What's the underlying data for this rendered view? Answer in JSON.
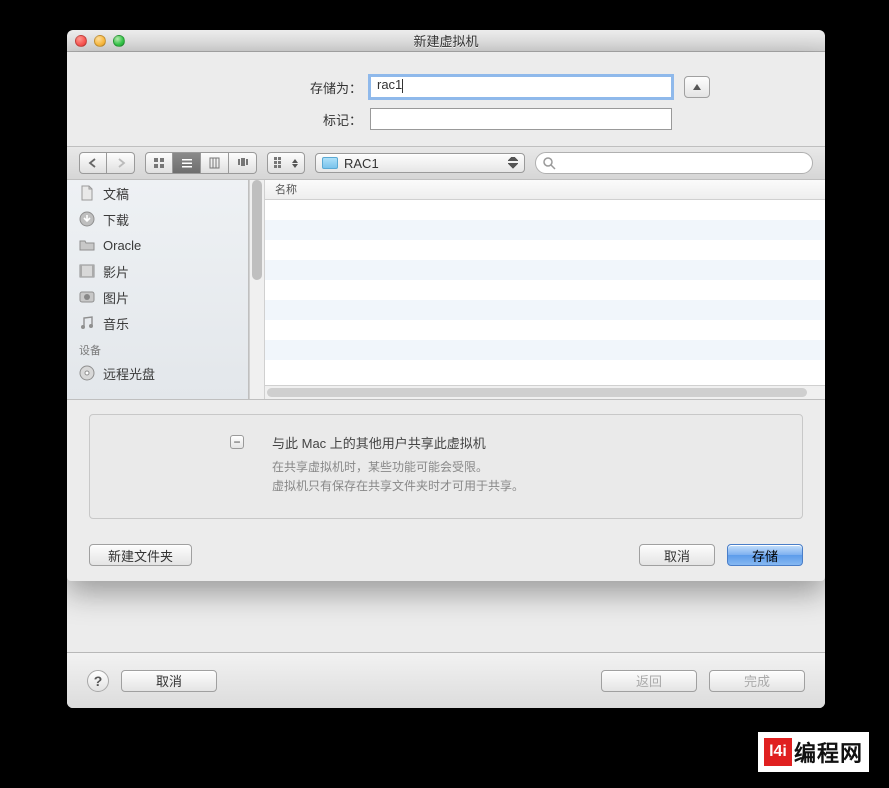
{
  "window": {
    "title": "新建虚拟机"
  },
  "save_form": {
    "save_as_label": "存储为：",
    "save_as_value": "rac1",
    "tags_label": "标记：",
    "tags_value": ""
  },
  "toolbar": {
    "location": "RAC1",
    "search_placeholder": ""
  },
  "sidebar": {
    "items": [
      {
        "label": "文稿",
        "icon": "doc"
      },
      {
        "label": "下载",
        "icon": "download"
      },
      {
        "label": "Oracle",
        "icon": "folder"
      },
      {
        "label": "影片",
        "icon": "movie"
      },
      {
        "label": "图片",
        "icon": "photo"
      },
      {
        "label": "音乐",
        "icon": "music"
      }
    ],
    "devices_header": "设备",
    "devices": [
      {
        "label": "远程光盘",
        "icon": "disc"
      }
    ]
  },
  "file_list": {
    "column_name": "名称"
  },
  "share": {
    "title": "与此 Mac 上的其他用户共享此虚拟机",
    "line1": "在共享虚拟机时，某些功能可能会受限。",
    "line2": "虚拟机只有保存在共享文件夹时才可用于共享。"
  },
  "sheet_actions": {
    "new_folder": "新建文件夹",
    "cancel": "取消",
    "save": "存储"
  },
  "bottom": {
    "cancel": "取消",
    "back": "返回",
    "finish": "完成"
  },
  "logo": {
    "mark": "l4i",
    "text": "编程网"
  }
}
